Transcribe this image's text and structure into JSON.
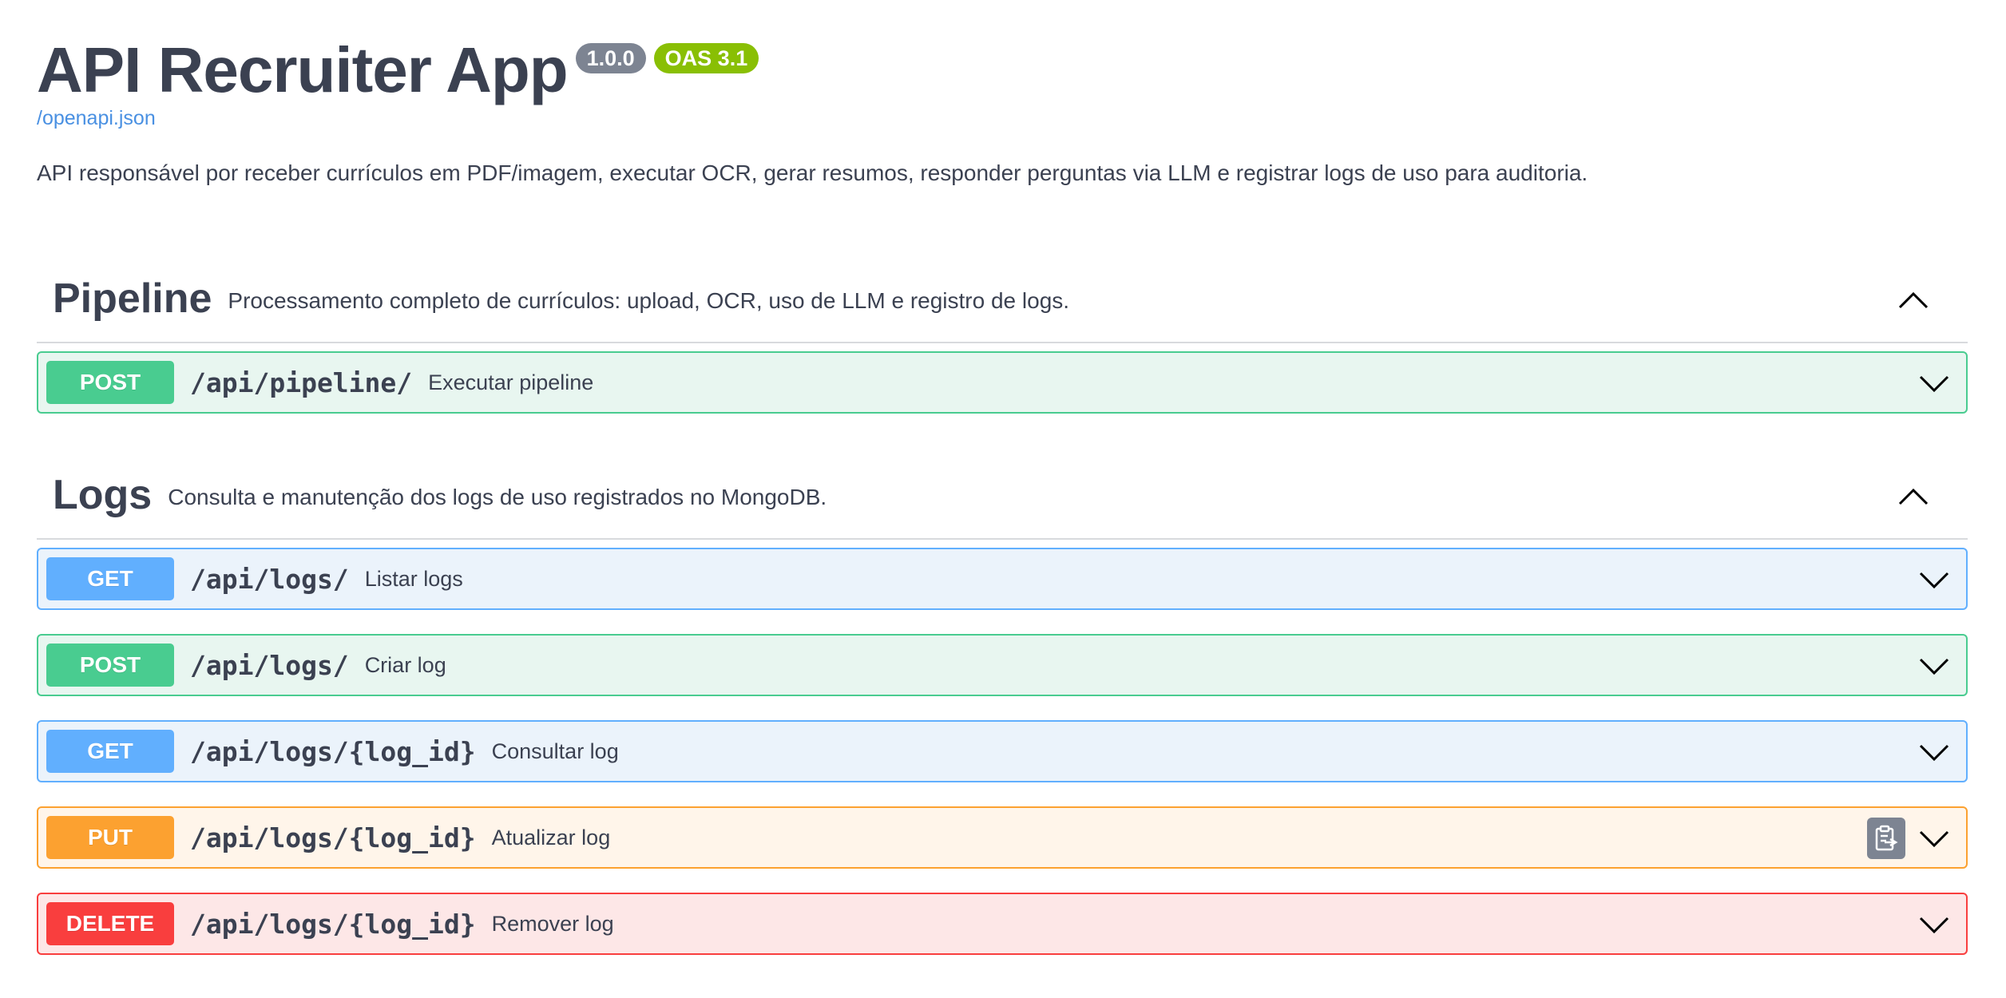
{
  "info": {
    "title": "API Recruiter App",
    "version": "1.0.0",
    "oas_version": "OAS 3.1",
    "spec_link": "/openapi.json",
    "description": "API responsável por receber currículos em PDF/imagem, executar OCR, gerar resumos, responder perguntas via LLM e registrar logs de uso para auditoria."
  },
  "sections": [
    {
      "name": "Pipeline",
      "description": "Processamento completo de currículos: upload, OCR, uso de LLM e registro de logs.",
      "expanded": true,
      "operations": [
        {
          "method": "POST",
          "path": "/api/pipeline/",
          "summary": "Executar pipeline"
        }
      ]
    },
    {
      "name": "Logs",
      "description": "Consulta e manutenção dos logs de uso registrados no MongoDB.",
      "expanded": true,
      "operations": [
        {
          "method": "GET",
          "path": "/api/logs/",
          "summary": "Listar logs"
        },
        {
          "method": "POST",
          "path": "/api/logs/",
          "summary": "Criar log"
        },
        {
          "method": "GET",
          "path": "/api/logs/{log_id}",
          "summary": "Consultar log"
        },
        {
          "method": "PUT",
          "path": "/api/logs/{log_id}",
          "summary": "Atualizar log"
        },
        {
          "method": "DELETE",
          "path": "/api/logs/{log_id}",
          "summary": "Remover log"
        }
      ]
    }
  ],
  "icons": {
    "collapse": "chevron-up-icon",
    "expand": "chevron-down-icon",
    "copy": "clipboard-copy-icon"
  },
  "colors": {
    "post": "#49cc90",
    "get": "#61affe",
    "put": "#fca130",
    "delete": "#f93e3e",
    "version_badge": "#7d8492",
    "oas_badge": "#89bf04",
    "link": "#4990e2"
  }
}
